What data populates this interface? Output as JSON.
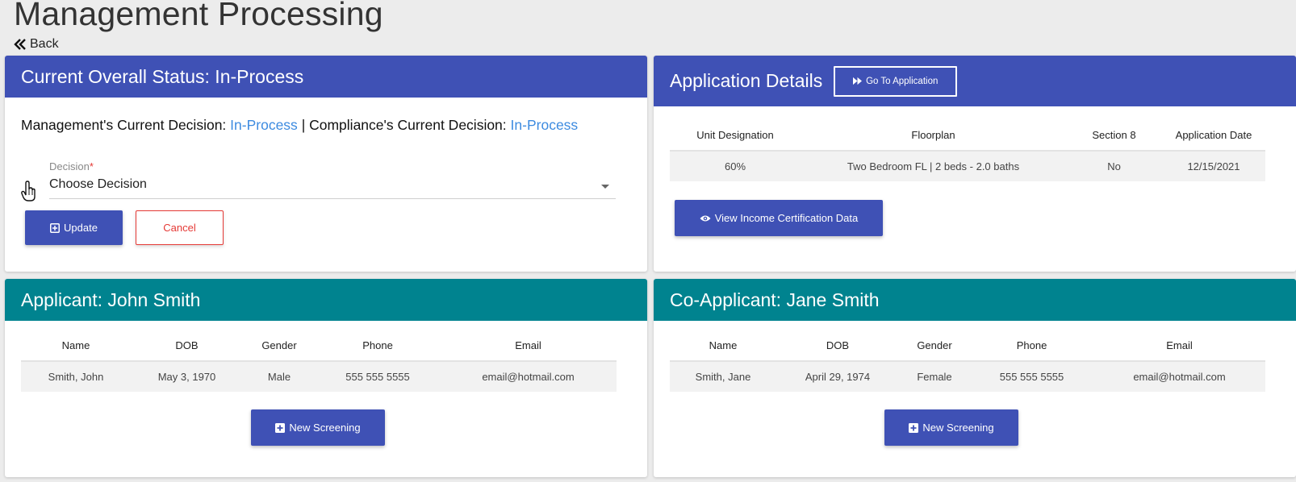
{
  "page": {
    "title": "Management Processing",
    "back_label": "Back"
  },
  "status_card": {
    "header": "Current Overall Status: In-Process",
    "management_label": "Management's Current Decision:",
    "management_value": "In-Process",
    "separator": "|",
    "compliance_label": "Compliance's Current Decision:",
    "compliance_value": "In-Process",
    "decision_label": "Decision",
    "decision_required_mark": "*",
    "decision_value": "Choose Decision",
    "update_label": "Update",
    "cancel_label": "Cancel"
  },
  "application_card": {
    "header": "Application Details",
    "goto_label": "Go To Application",
    "columns": [
      "Unit Designation",
      "Floorplan",
      "Section 8",
      "Application Date"
    ],
    "row": [
      "60%",
      "Two Bedroom FL | 2 beds - 2.0 baths",
      "No",
      "12/15/2021"
    ],
    "view_income_label": "View Income Certification Data"
  },
  "applicant_card": {
    "header": "Applicant: John Smith",
    "columns": [
      "Name",
      "DOB",
      "Gender",
      "Phone",
      "Email"
    ],
    "row": [
      "Smith, John",
      "May 3, 1970",
      "Male",
      "555 555 5555",
      "email@hotmail.com"
    ],
    "new_screening_label": "New Screening"
  },
  "coapplicant_card": {
    "header": "Co-Applicant: Jane Smith",
    "columns": [
      "Name",
      "DOB",
      "Gender",
      "Phone",
      "Email"
    ],
    "row": [
      "Smith, Jane",
      "April 29, 1974",
      "Female",
      "555 555 5555",
      "email@hotmail.com"
    ],
    "new_screening_label": "New Screening"
  },
  "colors": {
    "primary": "#3f51b5",
    "teal": "#00838f",
    "link": "#3d8be0",
    "danger": "#e53935"
  }
}
